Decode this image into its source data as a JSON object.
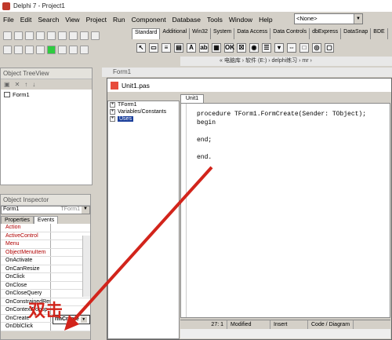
{
  "app": {
    "title": "Delphi 7 - Project1"
  },
  "menu": [
    "File",
    "Edit",
    "Search",
    "View",
    "Project",
    "Run",
    "Component",
    "Database",
    "Tools",
    "Window",
    "Help"
  ],
  "combo": {
    "value": "<None>"
  },
  "palette_tabs": [
    "Standard",
    "Additional",
    "Win32",
    "System",
    "Data Access",
    "Data Controls",
    "dbExpress",
    "DataSnap",
    "BDE"
  ],
  "path_bar": "« 电脑库 › 软件 (E:) › delphi练习 › mr ›",
  "tree_view": {
    "title": "Object TreeView",
    "item": "Form1"
  },
  "inspector": {
    "title": "Object Inspector",
    "object_name": "Form1",
    "object_type": "TForm1",
    "tabs": [
      "Properties",
      "Events"
    ],
    "events": [
      {
        "name": "Action",
        "value": "",
        "link": true
      },
      {
        "name": "ActiveControl",
        "value": "",
        "link": true
      },
      {
        "name": "Menu",
        "value": "",
        "link": true
      },
      {
        "name": "ObjectMenuItem",
        "value": "",
        "link": true
      },
      {
        "name": "OnActivate",
        "value": ""
      },
      {
        "name": "OnCanResize",
        "value": ""
      },
      {
        "name": "OnClick",
        "value": ""
      },
      {
        "name": "OnClose",
        "value": ""
      },
      {
        "name": "OnCloseQuery",
        "value": ""
      },
      {
        "name": "OnConstrainedResize",
        "value": ""
      },
      {
        "name": "OnContextPopup",
        "value": ""
      },
      {
        "name": "OnCreate",
        "value": "rmCreate"
      },
      {
        "name": "OnDblClick",
        "value": ""
      }
    ]
  },
  "form_title": "Form1",
  "editor": {
    "title": "Unit1.pas",
    "tab": "Unit1",
    "explorer": [
      "TForm1",
      "Variables/Constants",
      "Uses"
    ],
    "code": [
      "procedure TForm1.FormCreate(Sender: TObject);",
      "begin",
      "",
      "end;",
      "",
      "end."
    ],
    "status": {
      "pos": "27: 1",
      "state": "Modified",
      "mode": "Insert",
      "tab": "Code / Diagram"
    }
  },
  "annotation": {
    "label": "双击",
    "color": "#d2241b"
  }
}
